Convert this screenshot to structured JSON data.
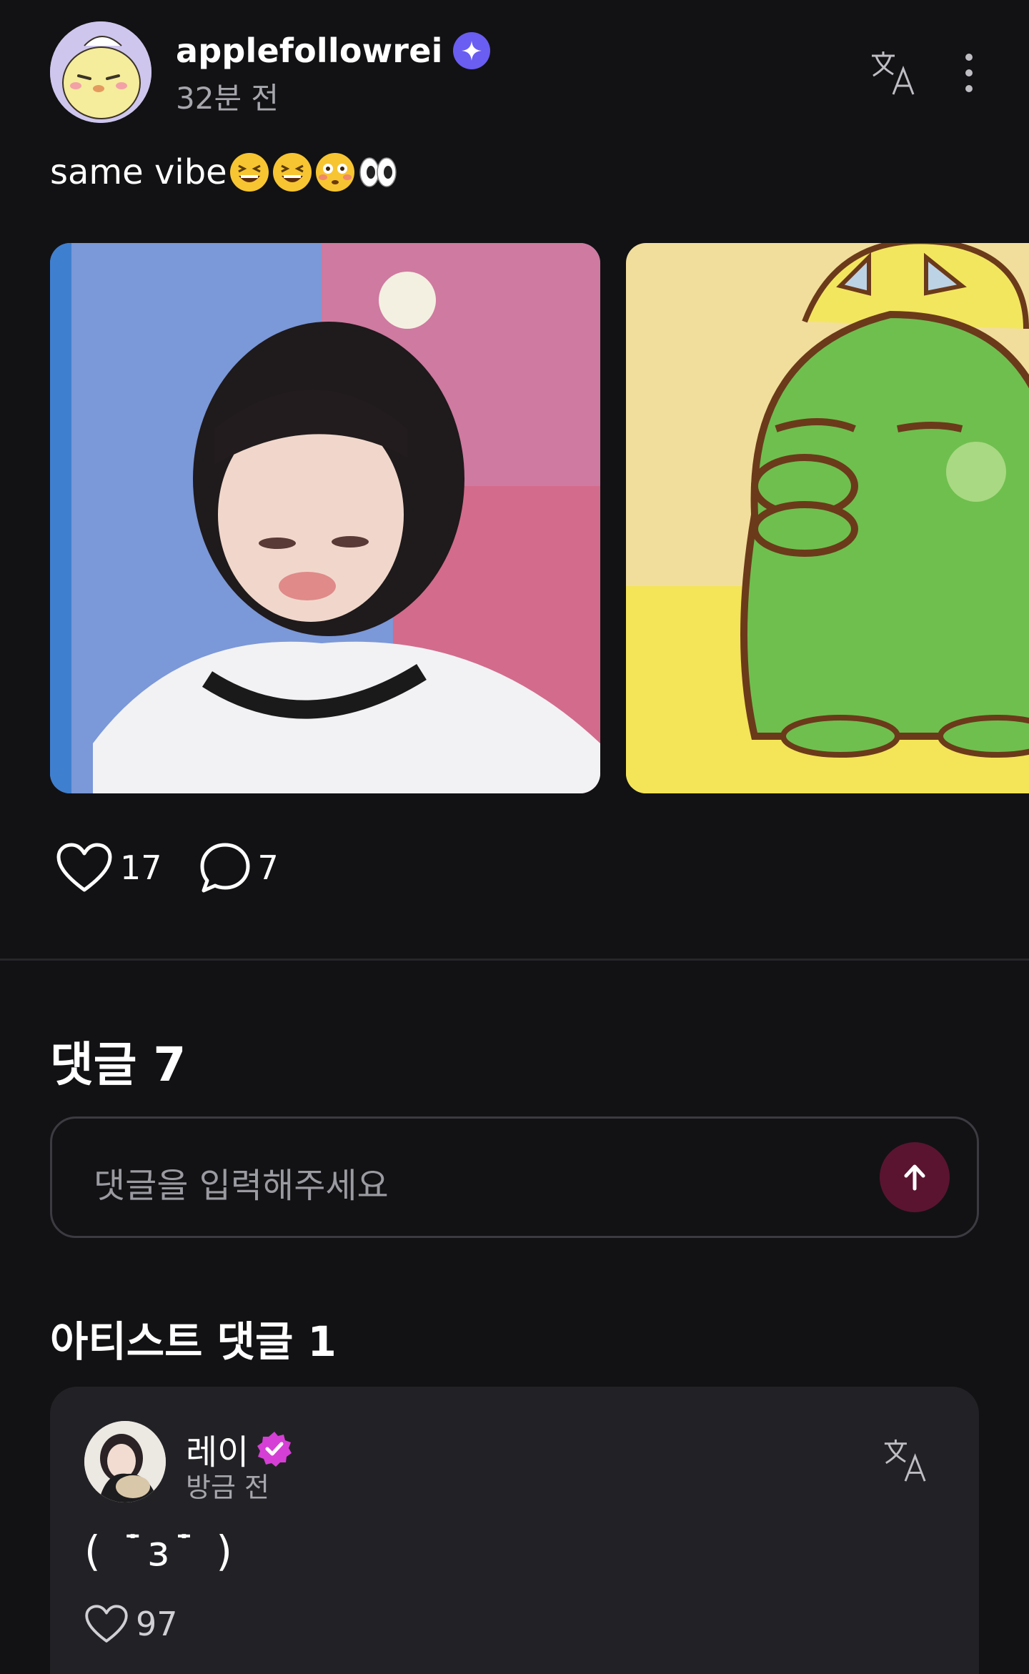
{
  "post": {
    "author": "applefollowrei",
    "time": "32분 전",
    "text": "same vibe",
    "emojis": [
      "grinning-squint-emoji",
      "grinning-squint-emoji",
      "flushed-emoji",
      "eyes-emoji"
    ],
    "images": [
      "photo-pouting-girl",
      "cartoon-green-character"
    ],
    "likes": "17",
    "comments": "7"
  },
  "comments_section": {
    "title": "댓글 7",
    "input_placeholder": "댓글을 입력해주세요"
  },
  "artist_section": {
    "title": "아티스트 댓글 1",
    "comment": {
      "name": "레이",
      "time": "방금 전",
      "text": "( ˙̄ɜ˙̄ )",
      "likes": "97"
    }
  },
  "colors": {
    "background": "#121214",
    "accent_sparkle": "#6a5df1",
    "artist_badge": "#d63fd5",
    "send_button": "#5a1430"
  }
}
